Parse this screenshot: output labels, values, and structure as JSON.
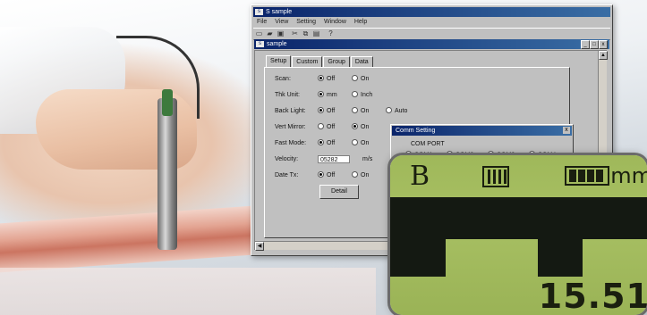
{
  "app": {
    "title": "S  sample",
    "menu": [
      "File",
      "View",
      "Setting",
      "Window",
      "Help"
    ],
    "child_title": "sample",
    "controls": [
      "_",
      "□",
      "x"
    ]
  },
  "toolbar": {
    "icons": [
      "new-icon",
      "open-icon",
      "save-icon",
      "cut-icon",
      "copy-icon",
      "paste-icon",
      "help-icon"
    ]
  },
  "tabs": [
    "Setup",
    "Custom",
    "Group",
    "Data"
  ],
  "setup": {
    "scan": {
      "label": "Scan:",
      "opts": [
        "Off",
        "On"
      ],
      "selected": 0
    },
    "thk_unit": {
      "label": "Thk Unit:",
      "opts": [
        "mm",
        "Inch"
      ],
      "selected": 0
    },
    "back_light": {
      "label": "Back Light:",
      "opts": [
        "Off",
        "On",
        "Auto"
      ],
      "selected": 0
    },
    "vert_mirror": {
      "label": "Vert Mirror:",
      "opts": [
        "Off",
        "On"
      ],
      "selected": 1
    },
    "fast_mode": {
      "label": "Fast Mode:",
      "opts": [
        "Off",
        "On"
      ],
      "selected": 0
    },
    "velocity": {
      "label": "Velocity:",
      "value": "05282",
      "unit": "m/s"
    },
    "date_tx": {
      "label": "Date Tx:",
      "opts": [
        "Off",
        "On"
      ],
      "selected": 0
    },
    "detail_label": "Detail"
  },
  "dialog": {
    "title": "Comm Setting",
    "close": "x",
    "group_label": "COM PORT",
    "ports": [
      "COM1",
      "COM2",
      "COM3",
      "COM4"
    ],
    "selected_port": 0
  },
  "lcd": {
    "mode_letter": "B",
    "unit": "mm",
    "reading": "15.51",
    "color": "#a8c063"
  }
}
